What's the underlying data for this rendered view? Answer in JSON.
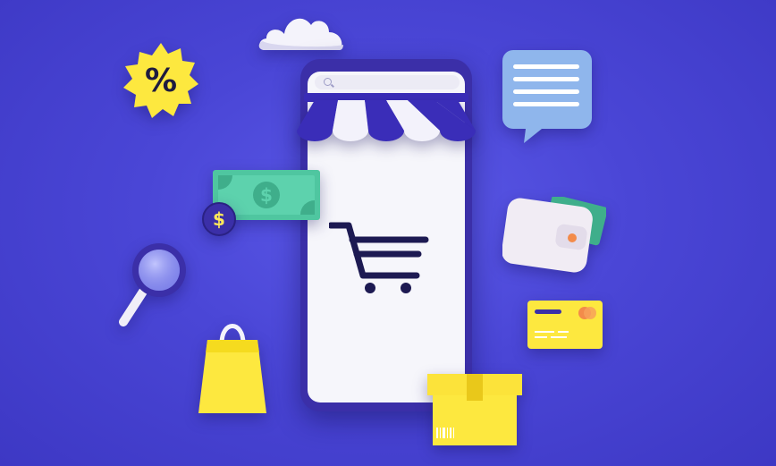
{
  "badge": {
    "text": "%"
  },
  "coin": {
    "symbol": "$"
  },
  "colors": {
    "background": "#4a46d6",
    "phone_frame": "#3b2fa8",
    "screen": "#f6f6fb",
    "awning_stripe_dark": "#3a2db8",
    "awning_stripe_light": "#f3f2fb",
    "accent_yellow": "#fde83f",
    "money_green": "#4fc6a0",
    "chat_blue": "#8fb6ec",
    "wallet": "#f1ecf4",
    "cart": "#1d1a52"
  },
  "icons": [
    "cloud-icon",
    "percent-badge-icon",
    "chat-bubble-icon",
    "money-bill-icon",
    "dollar-coin-icon",
    "magnifier-icon",
    "wallet-icon",
    "credit-card-icon",
    "shopping-bag-icon",
    "package-box-icon",
    "shopping-cart-icon",
    "storefront-awning-icon"
  ]
}
